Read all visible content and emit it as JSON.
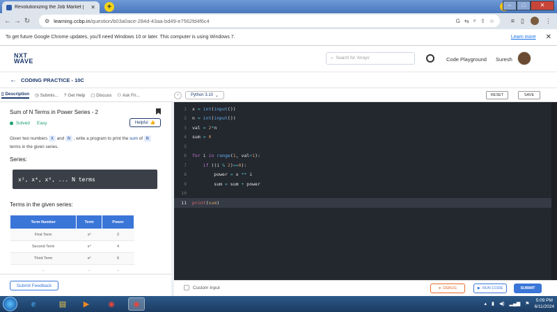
{
  "browser": {
    "tab_title": "Revolutionizing the Job Market |",
    "url_main": "learning.ccbp.in",
    "url_path": "/question/b03a0ace-284d-43aa-bd49-e7562fd4f6c4",
    "info_message": "To get future Google Chrome updates, you'll need Windows 10 or later. This computer is using Windows 7.",
    "learn_more": "Learn more"
  },
  "header": {
    "logo_line1": "NXT",
    "logo_line2": "WAVE",
    "search_placeholder": "Search for 'Arrays'",
    "code_playground": "Code Playground",
    "user_name": "Suresh"
  },
  "breadcrumb": {
    "title": "CODING PRACTICE - 10C"
  },
  "left_tabs": [
    {
      "label": "Description"
    },
    {
      "label": "Submis..."
    },
    {
      "label": "Get Help"
    },
    {
      "label": "Discuss"
    },
    {
      "label": "Ask Fri..."
    }
  ],
  "editor_toolbar": {
    "language": "Python 3.10",
    "reset": "RESET",
    "save": "SAVE"
  },
  "problem": {
    "title": "Sum of N Terms in Power Series - 2",
    "status": "Solved",
    "difficulty": "Easy",
    "helpful": "Helpful",
    "desc_part1": "Given two numbers",
    "var_x": "X",
    "desc_and": "and",
    "var_n": "N",
    "desc_part2": ", write a program to print the",
    "desc_sum": "sum",
    "desc_of": "of",
    "desc_part3": "terms in the given series.",
    "series_heading": "Series:",
    "series_text": "x², x⁴, x⁶, ... N terms",
    "terms_heading": "Terms in the given series:",
    "table_headers": [
      "Term Number",
      "Term",
      "Power"
    ],
    "table_rows": [
      [
        "First Term",
        "x²",
        "2"
      ],
      [
        "Second Term",
        "x⁴",
        "4"
      ],
      [
        "Third Term",
        "x⁶",
        "6"
      ],
      [
        "..",
        "..",
        ".."
      ]
    ],
    "submit_feedback": "Submit Feedback"
  },
  "code_lines": [
    {
      "num": "1",
      "tokens": [
        [
          "vr",
          "x "
        ],
        [
          "op",
          "= "
        ],
        [
          "fn",
          "int"
        ],
        [
          "vr",
          "("
        ],
        [
          "fn",
          "input"
        ],
        [
          "vr",
          "())"
        ]
      ]
    },
    {
      "num": "2",
      "tokens": [
        [
          "vr",
          "n "
        ],
        [
          "op",
          "= "
        ],
        [
          "fn",
          "int"
        ],
        [
          "vr",
          "("
        ],
        [
          "fn",
          "input"
        ],
        [
          "vr",
          "())"
        ]
      ]
    },
    {
      "num": "3",
      "tokens": [
        [
          "vr",
          "val "
        ],
        [
          "op",
          "= "
        ],
        [
          "nm",
          "2"
        ],
        [
          "op",
          "*"
        ],
        [
          "vr",
          "n"
        ]
      ]
    },
    {
      "num": "4",
      "tokens": [
        [
          "vr",
          "sum "
        ],
        [
          "op",
          "= "
        ],
        [
          "nm",
          "0"
        ]
      ]
    },
    {
      "num": "5",
      "tokens": []
    },
    {
      "num": "6",
      "tokens": [
        [
          "kw",
          "for "
        ],
        [
          "vr",
          "i "
        ],
        [
          "kw",
          "in "
        ],
        [
          "fn",
          "range"
        ],
        [
          "vr",
          "("
        ],
        [
          "nm",
          "1"
        ],
        [
          "vr",
          ", val"
        ],
        [
          "op",
          "+"
        ],
        [
          "nm",
          "1"
        ],
        [
          "vr",
          "):"
        ]
      ]
    },
    {
      "num": "7",
      "tokens": [
        [
          "vr",
          "    "
        ],
        [
          "kw",
          "if "
        ],
        [
          "vr",
          "((i "
        ],
        [
          "op",
          "% "
        ],
        [
          "nm",
          "2"
        ],
        [
          "vr",
          ")"
        ],
        [
          "op",
          "=="
        ],
        [
          "nm",
          "0"
        ],
        [
          "vr",
          "):"
        ]
      ]
    },
    {
      "num": "8",
      "tokens": [
        [
          "vr",
          "        power "
        ],
        [
          "op",
          "= "
        ],
        [
          "vr",
          "x "
        ],
        [
          "op",
          "** "
        ],
        [
          "vr",
          "i"
        ]
      ]
    },
    {
      "num": "9",
      "tokens": [
        [
          "vr",
          "        sum "
        ],
        [
          "op",
          "= "
        ],
        [
          "vr",
          "sum "
        ],
        [
          "op",
          "+ "
        ],
        [
          "vr",
          "power"
        ]
      ]
    },
    {
      "num": "10",
      "tokens": []
    },
    {
      "num": "11",
      "tokens": [
        [
          "pm",
          "print"
        ],
        [
          "vr",
          "("
        ],
        [
          "nm",
          "sum"
        ],
        [
          "vr",
          ")"
        ]
      ]
    }
  ],
  "bottom": {
    "custom_input": "Custom Input",
    "debug": "DEBUG",
    "run_code": "RUN CODE",
    "submit": "SUBMIT"
  },
  "taskbar": {
    "time": "5:09 PM",
    "date": "6/11/2024"
  }
}
